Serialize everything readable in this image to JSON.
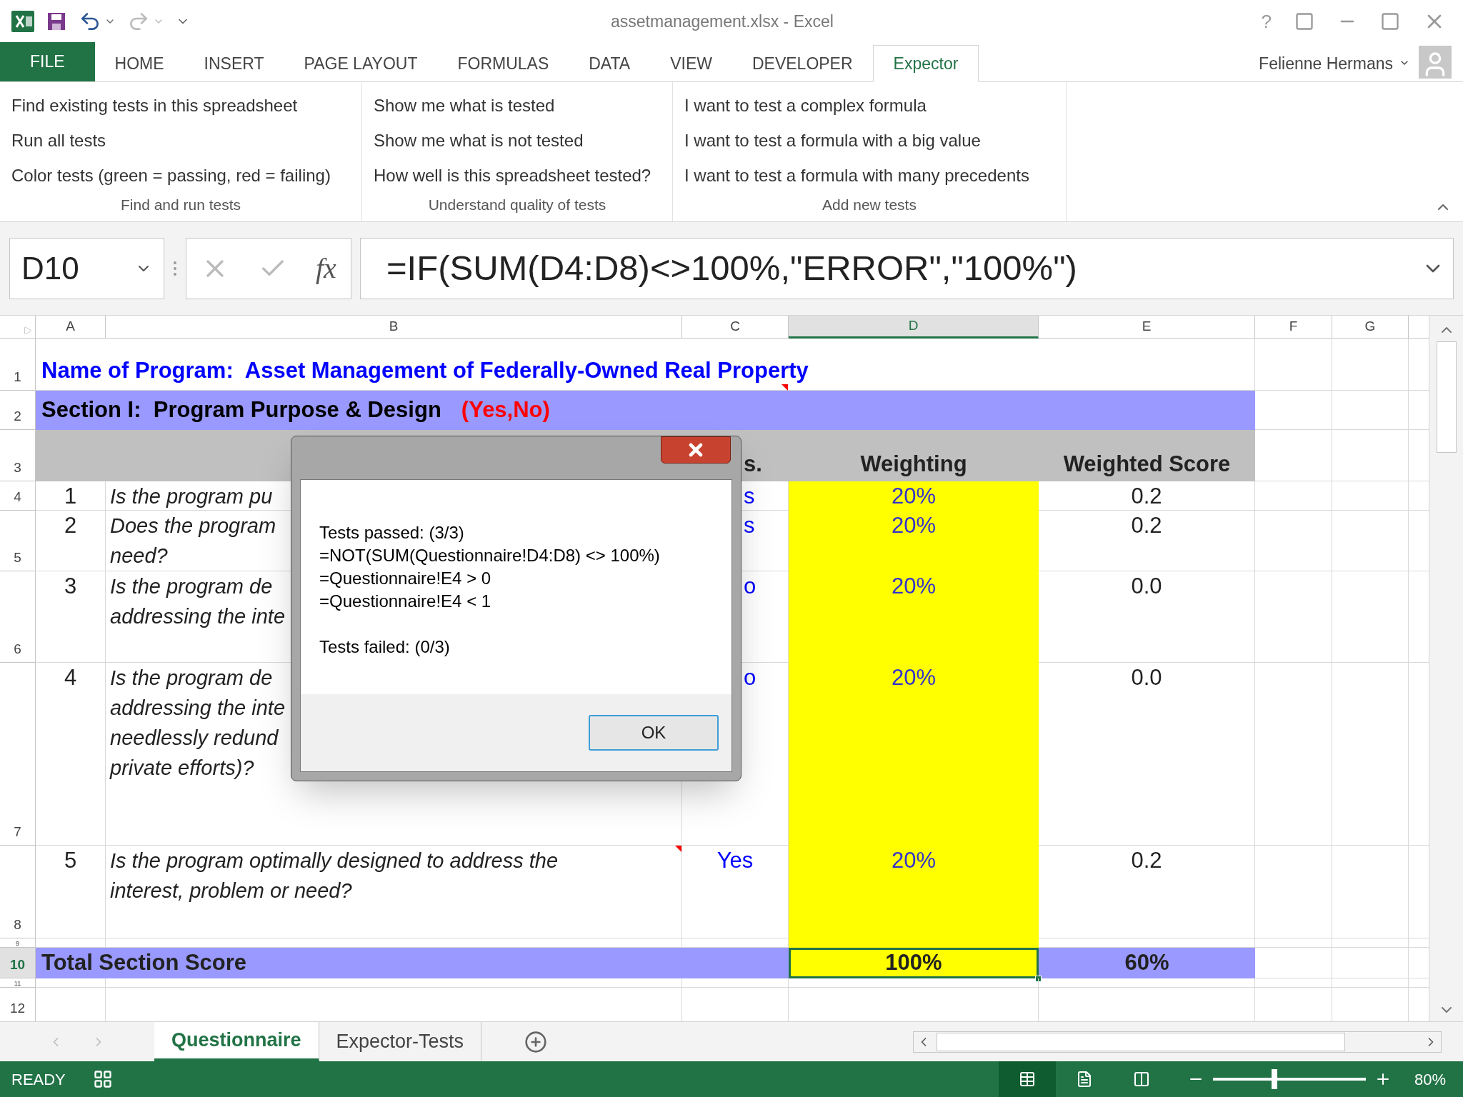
{
  "title_bar": {
    "title": "assetmanagement.xlsx - Excel",
    "help": "?"
  },
  "ribbon_tabs": [
    {
      "label": "FILE",
      "kind": "file",
      "selected": false
    },
    {
      "label": "HOME",
      "kind": "tab",
      "selected": false
    },
    {
      "label": "INSERT",
      "kind": "tab",
      "selected": false
    },
    {
      "label": "PAGE LAYOUT",
      "kind": "tab",
      "selected": false
    },
    {
      "label": "FORMULAS",
      "kind": "tab",
      "selected": false
    },
    {
      "label": "DATA",
      "kind": "tab",
      "selected": false
    },
    {
      "label": "VIEW",
      "kind": "tab",
      "selected": false
    },
    {
      "label": "DEVELOPER",
      "kind": "tab",
      "selected": false
    },
    {
      "label": "Expector",
      "kind": "tab",
      "selected": true
    }
  ],
  "account": {
    "name": "Felienne Hermans"
  },
  "ribbon_groups": [
    {
      "label": "Find and run tests",
      "buttons": [
        "Find existing tests in this spreadsheet",
        "Run all tests",
        "Color tests (green = passing, red = failing)"
      ]
    },
    {
      "label": "Understand quality of tests",
      "buttons": [
        "Show me what is tested",
        "Show me what is not tested",
        "How well is this spreadsheet tested?"
      ]
    },
    {
      "label": "Add new tests",
      "buttons": [
        "I want to test a complex formula",
        "I want to test a formula with a big value",
        "I want to test a formula with many precedents"
      ]
    }
  ],
  "formula_bar": {
    "name_box": "D10",
    "function_label": "fx",
    "formula": "=IF(SUM(D4:D8)<>100%,\"ERROR\",\"100%\")"
  },
  "columns": [
    {
      "label": "A",
      "selected": false
    },
    {
      "label": "B",
      "selected": false
    },
    {
      "label": "C",
      "selected": false
    },
    {
      "label": "D",
      "selected": true
    },
    {
      "label": "E",
      "selected": false
    },
    {
      "label": "F",
      "selected": false
    },
    {
      "label": "G",
      "selected": false
    }
  ],
  "rows": [
    {
      "number": "1",
      "kind": "title",
      "selected": false,
      "text": "Name of Program:  Asset Management of Federally-Owned Real Property",
      "comment": true
    },
    {
      "number": "2",
      "kind": "section",
      "selected": false,
      "text": "Section I:  Program Purpose & Design",
      "note": "(Yes,No)"
    },
    {
      "number": "3",
      "kind": "header",
      "selected": false,
      "cells": {
        "c": "s.",
        "d": "Weighting",
        "e": "Weighted Score"
      }
    },
    {
      "number": "4",
      "kind": "question",
      "selected": false,
      "cells": {
        "a": "1",
        "b": "Is the program pu",
        "c": "s",
        "d": "20%",
        "e": "0.2"
      }
    },
    {
      "number": "5",
      "kind": "question",
      "selected": false,
      "cells": {
        "a": "2",
        "b": "Does the program\nneed?",
        "c": "s",
        "d": "20%",
        "e": "0.2"
      }
    },
    {
      "number": "6",
      "kind": "question",
      "selected": false,
      "cells": {
        "a": "3",
        "b": "Is the program de\naddressing the inte",
        "c": "o",
        "d": "20%",
        "e": "0.0"
      }
    },
    {
      "number": "7",
      "kind": "question",
      "selected": false,
      "cells": {
        "a": "4",
        "b": "Is the program de\naddressing the inte\nneedlessly redund\nprivate efforts)?",
        "c": "o",
        "d": "20%",
        "e": "0.0"
      }
    },
    {
      "number": "8",
      "kind": "question",
      "selected": false,
      "comment": true,
      "cells": {
        "a": "5",
        "b": "Is the program optimally designed to address the\ninterest, problem or need?",
        "c": "Yes",
        "d": "20%",
        "e": "0.2"
      }
    },
    {
      "number": "9",
      "kind": "spacer",
      "selected": false
    },
    {
      "number": "10",
      "kind": "total",
      "selected": true,
      "cells": {
        "a": "Total Section Score",
        "d": "100%",
        "e": "60%"
      }
    },
    {
      "number": "11",
      "kind": "spacer",
      "selected": false
    },
    {
      "number": "12",
      "kind": "spacer",
      "selected": false
    }
  ],
  "dialog": {
    "passed": "Tests passed: (3/3)",
    "tests": [
      "=NOT(SUM(Questionnaire!D4:D8) <> 100%)",
      "=Questionnaire!E4 > 0",
      "=Questionnaire!E4 < 1"
    ],
    "failed": "Tests failed: (0/3)",
    "ok": "OK"
  },
  "sheet_tabs": [
    {
      "label": "Questionnaire",
      "selected": true
    },
    {
      "label": "Expector-Tests",
      "selected": false
    }
  ],
  "status_bar": {
    "mode": "READY",
    "views": [
      {
        "kind": "normal",
        "selected": true
      },
      {
        "kind": "page_layout",
        "selected": false
      },
      {
        "kind": "page_break",
        "selected": false
      }
    ],
    "zoom_slider": {
      "level": 0.4
    },
    "zoom": "80%"
  }
}
